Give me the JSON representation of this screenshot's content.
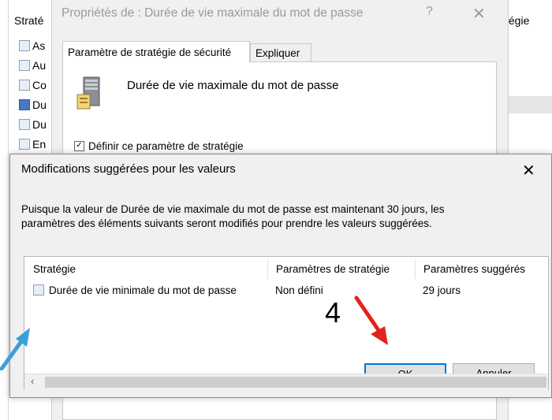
{
  "background": {
    "column_header_left": "Straté",
    "column_header_right": "tégie",
    "rows": [
      {
        "label": "As",
        "selected": false
      },
      {
        "label": "Au",
        "selected": false
      },
      {
        "label": "Co",
        "selected": false
      },
      {
        "label": "Du",
        "selected": true
      },
      {
        "label": "Du",
        "selected": false
      },
      {
        "label": "En",
        "selected": false
      }
    ]
  },
  "properties_dialog": {
    "title": "Propriétés de : Durée de vie maximale du mot de passe",
    "help_glyph": "?",
    "close_glyph": "✕",
    "tabs": [
      {
        "label": "Paramètre de stratégie de sécurité",
        "active": true
      },
      {
        "label": "Expliquer",
        "active": false
      }
    ],
    "policy_heading": "Durée de vie maximale du mot de passe",
    "define_checkbox_label": "Définir ce paramètre de stratégie",
    "define_checked": true
  },
  "suggested_dialog": {
    "title": "Modifications suggérées pour les valeurs",
    "close_glyph": "✕",
    "message_line1": "Puisque la valeur de Durée de vie maximale du mot de passe est maintenant 30 jours, les",
    "message_line2": "paramètres des éléments suivants seront modifiés pour prendre les valeurs suggérées.",
    "columns": [
      "Stratégie",
      "Paramètres de stratégie",
      "Paramètres suggérés"
    ],
    "rows": [
      {
        "policy": "Durée de vie minimale du mot de passe",
        "current": "Non défini",
        "suggested": "29 jours"
      }
    ],
    "scroll_left_glyph": "‹",
    "ok_label": "OK",
    "cancel_label": "Annuler"
  },
  "annotations": {
    "step_number": "4",
    "arrow_red_color": "#e3231b",
    "arrow_blue_color": "#3aa0dc"
  }
}
